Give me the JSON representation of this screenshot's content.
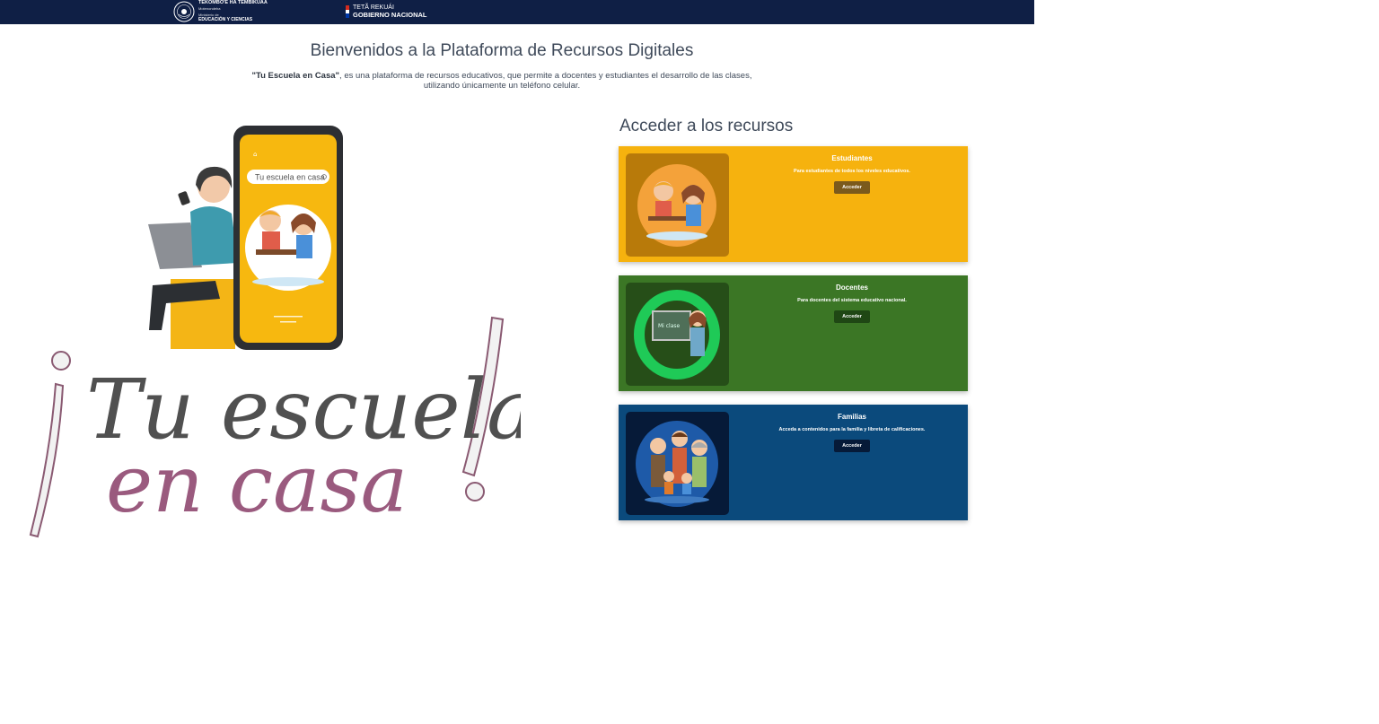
{
  "header": {
    "ministry_line1": "TEKOMBO'E HA TEMBIKUAA",
    "ministry_line2": "Motenondeha",
    "ministry_line3": "Ministerio de",
    "ministry_line4": "EDUCACIÓN Y CIENCIAS",
    "gov_line1": "TETÃ REKUÁI",
    "gov_line2": "GOBIERNO NACIONAL",
    "bg_color": "#0f1f45"
  },
  "page": {
    "title": "Bienvenidos a la Plataforma de Recursos Digitales",
    "intro_bold": "\"Tu Escuela en Casa\"",
    "intro_rest": ", es una plataforma de recursos educativos, que permite a docentes y estudiantes el desarrollo de las clases,",
    "intro_line2": "utilizando únicamente un teléfono celular."
  },
  "hero": {
    "search_placeholder": "Tu escuela en casa",
    "logo_text": "¡Tu escuela en casa!"
  },
  "access": {
    "title": "Acceder a los recursos",
    "cards": [
      {
        "title": "Estudiantes",
        "description": "Para estudiantes de todos los niveles educativos.",
        "button": "Acceder",
        "color": "#f6b20e",
        "button_color": "#7b5a1c"
      },
      {
        "title": "Docentes",
        "description": "Para docentes del sistema educativo nacional.",
        "button": "Acceder",
        "color": "#3b7625",
        "button_color": "#1f4714"
      },
      {
        "title": "Familias",
        "description": "Acceda a contenidos para la familia y libreta de calificaciones.",
        "button": "Acceder",
        "color": "#0b4a7c",
        "button_color": "#061a38"
      }
    ]
  }
}
